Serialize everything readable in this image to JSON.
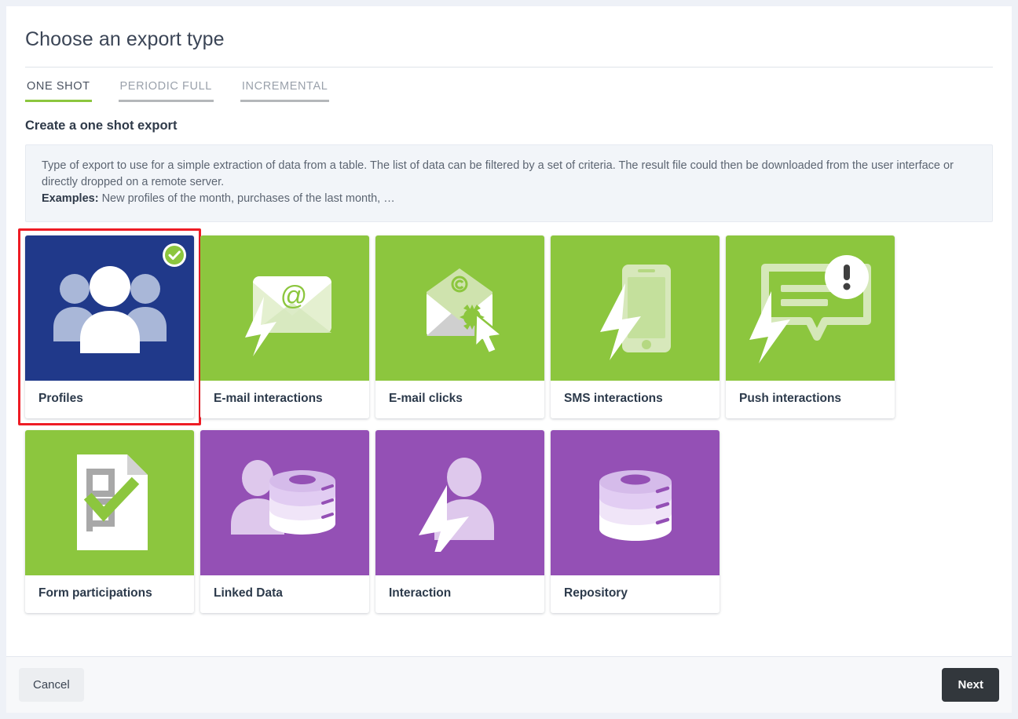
{
  "header": {
    "title": "Choose an export type"
  },
  "tabs": [
    {
      "label": "ONE SHOT",
      "active": true
    },
    {
      "label": "PERIODIC FULL",
      "active": false
    },
    {
      "label": "INCREMENTAL",
      "active": false
    }
  ],
  "section": {
    "title": "Create a one shot export",
    "description": "Type of export to use for a simple extraction of data from a table. The list of data can be filtered by a set of criteria. The result file could then be downloaded from the user interface or directly dropped on a remote server.",
    "examples_label": "Examples:",
    "examples_text": "New profiles of the month, purchases of the last month, …"
  },
  "cards": [
    {
      "label": "Profiles",
      "icon": "people-icon",
      "color": "#20398a",
      "selected": true
    },
    {
      "label": "E-mail interactions",
      "icon": "envelope-at-bolt-icon",
      "color": "#8cc63e",
      "selected": false
    },
    {
      "label": "E-mail clicks",
      "icon": "envelope-click-icon",
      "color": "#8cc63e",
      "selected": false
    },
    {
      "label": "SMS interactions",
      "icon": "phone-bolt-icon",
      "color": "#8cc63e",
      "selected": false
    },
    {
      "label": "Push interactions",
      "icon": "speech-alert-icon",
      "color": "#8cc63e",
      "selected": false
    },
    {
      "label": "Form participations",
      "icon": "form-check-icon",
      "color": "#8cc63e",
      "selected": false
    },
    {
      "label": "Linked Data",
      "icon": "person-database-icon",
      "color": "#9450b5",
      "selected": false
    },
    {
      "label": "Interaction",
      "icon": "person-bolt-icon",
      "color": "#9450b5",
      "selected": false
    },
    {
      "label": "Repository",
      "icon": "database-icon",
      "color": "#9450b5",
      "selected": false
    }
  ],
  "footer": {
    "cancel_label": "Cancel",
    "next_label": "Next"
  },
  "colors": {
    "green": "#8cc63e",
    "blue": "#20398a",
    "purple": "#9450b5",
    "selection_outline": "#ee1c25",
    "check_badge": "#8cc63e",
    "next_button": "#32373c"
  }
}
